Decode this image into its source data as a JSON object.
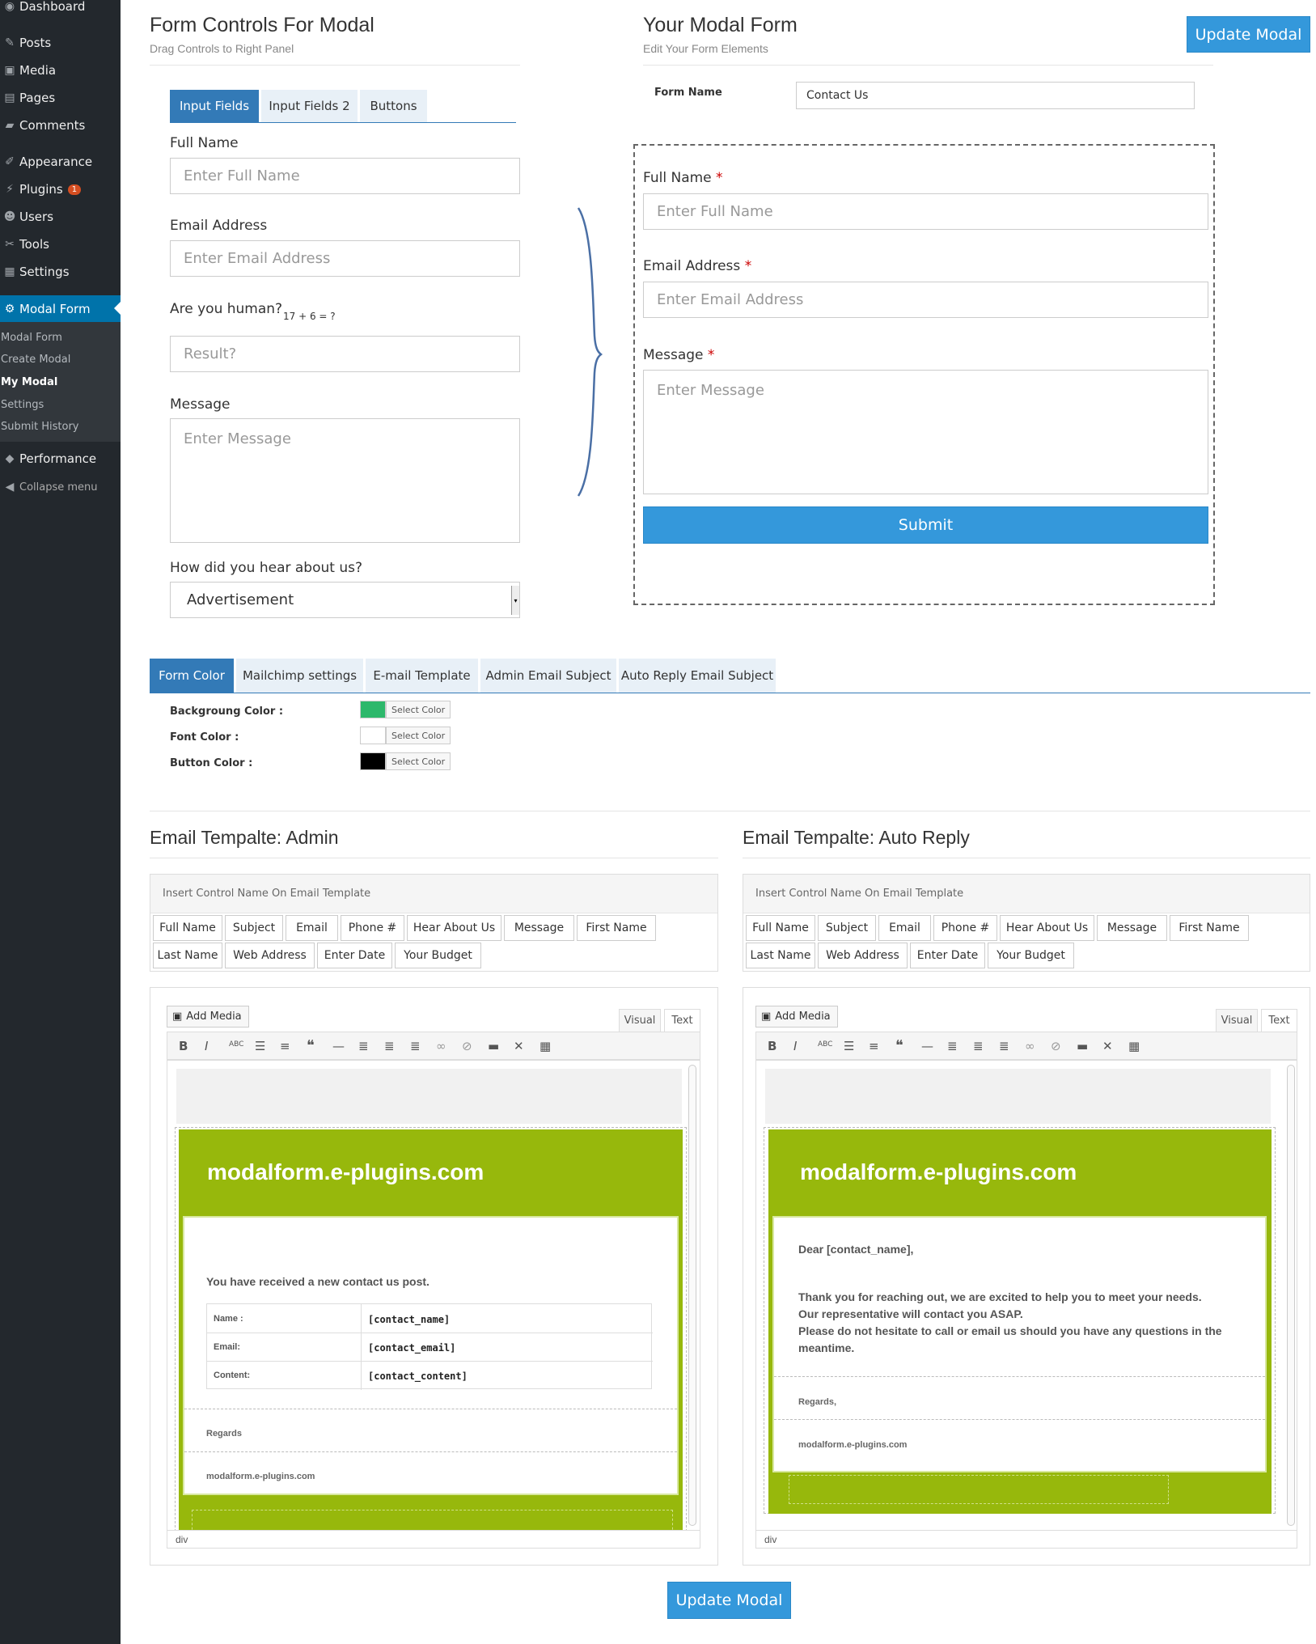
{
  "sidebar": {
    "items": [
      {
        "label": "Dashboard",
        "icon": "dashboard-icon"
      },
      {
        "label": "Posts",
        "icon": "pin-icon"
      },
      {
        "label": "Media",
        "icon": "media-icon"
      },
      {
        "label": "Pages",
        "icon": "pages-icon"
      },
      {
        "label": "Comments",
        "icon": "comment-icon"
      },
      {
        "label": "Appearance",
        "icon": "brush-icon"
      },
      {
        "label": "Plugins",
        "icon": "plug-icon",
        "badge": "1"
      },
      {
        "label": "Users",
        "icon": "users-icon"
      },
      {
        "label": "Tools",
        "icon": "wrench-icon"
      },
      {
        "label": "Settings",
        "icon": "settings-icon"
      },
      {
        "label": "Modal Form",
        "icon": "gear-icon"
      },
      {
        "label": "Performance",
        "icon": "performance-icon"
      },
      {
        "label": "Collapse menu",
        "icon": "collapse-icon"
      }
    ],
    "submenu": [
      "Modal Form",
      "Create Modal",
      "My Modal",
      "Settings",
      "Submit History"
    ]
  },
  "left": {
    "title": "Form Controls For Modal",
    "subtitle": "Drag Controls to Right Panel",
    "tabs": [
      "Input Fields",
      "Input Fields 2",
      "Buttons"
    ],
    "full_name_label": "Full Name",
    "full_name_placeholder": "Enter Full Name",
    "email_label": "Email Address",
    "email_placeholder": "Enter Email Address",
    "human_label": "Are you human?",
    "captcha": "17 + 6 = ?",
    "result_placeholder": "Result?",
    "message_label": "Message",
    "message_placeholder": "Enter Message",
    "hear_label": "How did you hear about us?",
    "hear_value": "Advertisement"
  },
  "right": {
    "title": "Your Modal Form",
    "subtitle": "Edit Your Form Elements",
    "update_label": "Update Modal",
    "form_name_label": "Form Name",
    "form_name_value": "Contact Us",
    "full_name_label": "Full Name",
    "full_name_placeholder": "Enter Full Name",
    "email_label": "Email Address",
    "email_placeholder": "Enter Email Address",
    "message_label": "Message",
    "message_placeholder": "Enter Message",
    "required_mark": "*",
    "submit_label": "Submit"
  },
  "settings": {
    "tabs": [
      "Form Color",
      "Mailchimp settings",
      "E-mail Template",
      "Admin Email Subject",
      "Auto Reply Email Subject"
    ],
    "rows": [
      {
        "label": "Backgroung Color :",
        "color": "#2db86b",
        "button": "Select Color"
      },
      {
        "label": "Font Color :",
        "color": "#ffffff",
        "button": "Select Color"
      },
      {
        "label": "Button Color :",
        "color": "#000000",
        "button": "Select Color"
      }
    ]
  },
  "email_admin": {
    "title": "Email Tempalte: Admin",
    "panel_head": "Insert Control Name On Email Template",
    "tokens": [
      "Full Name",
      "Subject",
      "Email",
      "Phone #",
      "Hear About Us",
      "Message",
      "First Name",
      "Last Name",
      "Web Address",
      "Enter Date",
      "Your Budget"
    ],
    "add_media": "Add Media",
    "visual": "Visual",
    "text": "Text",
    "brand": "modalform.e-plugins.com",
    "intro": "You have received a new contact us post.",
    "table": [
      {
        "k": "Name :",
        "v": "[contact_name]"
      },
      {
        "k": "Email:",
        "v": "[contact_email]"
      },
      {
        "k": "Content:",
        "v": "[contact_content]"
      }
    ],
    "regards": "Regards",
    "footer": "modalform.e-plugins.com",
    "status": "div"
  },
  "email_reply": {
    "title": "Email Tempalte: Auto Reply",
    "panel_head": "Insert Control Name On Email Template",
    "tokens": [
      "Full Name",
      "Subject",
      "Email",
      "Phone #",
      "Hear About Us",
      "Message",
      "First Name",
      "Last Name",
      "Web Address",
      "Enter Date",
      "Your Budget"
    ],
    "add_media": "Add Media",
    "visual": "Visual",
    "text": "Text",
    "brand": "modalform.e-plugins.com",
    "greeting": "Dear [contact_name],",
    "body1": "Thank you for reaching out, we are excited to help you to meet your needs.",
    "body2": "Our representative will contact you ASAP.",
    "body3": "Please do not hesitate to call or email us should you have any questions in the meantime.",
    "regards": "Regards,",
    "footer": "modalform.e-plugins.com",
    "status": "div"
  },
  "bottom_update_label": "Update Modal",
  "colors": {
    "accent": "#3498db",
    "sidebar": "#23282d",
    "active": "#0073aa",
    "email_green": "#97b80c"
  }
}
